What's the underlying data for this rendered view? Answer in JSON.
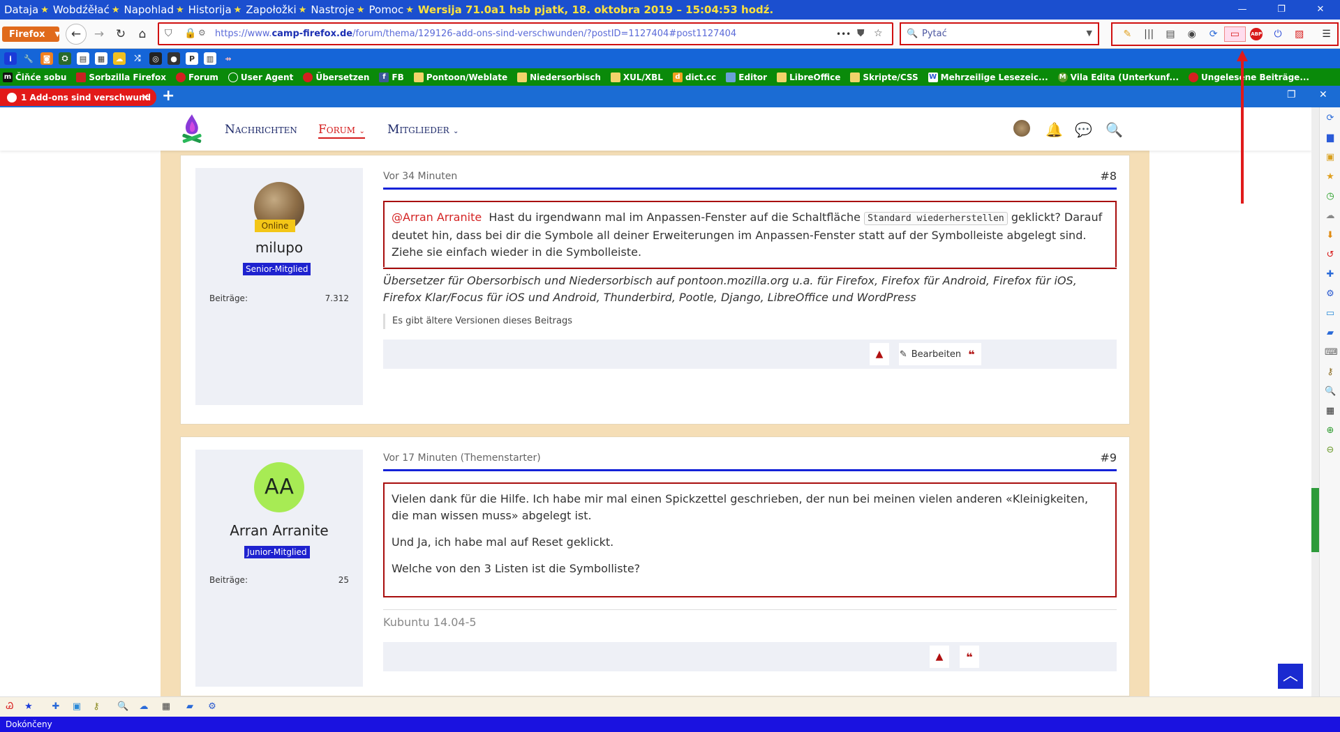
{
  "menubar": {
    "items": [
      "Dataja",
      "Wobdźěłać",
      "Napohlad",
      "Historija",
      "Zapołožki",
      "Nastroje",
      "Pomoc"
    ],
    "window_info": "Wersija 71.0a1 hsb   pjatk, 18. oktobra 2019  –  15:04:53 hodź."
  },
  "navbar": {
    "app_button": "Firefox",
    "url_prefix": "https://www.",
    "url_host": "camp-firefox.de",
    "url_path": "/forum/thema/129126-add-ons-sind-verschwunden/?postID=1127404#post1127404",
    "search_placeholder": "Pytać",
    "dots": "•••"
  },
  "bookmarks2": [
    {
      "label": "Čiňće sobu",
      "color": "#111"
    },
    {
      "label": "Sorbzilla Firefox",
      "color": "#c72222"
    },
    {
      "label": "Forum",
      "color": "#d42020"
    },
    {
      "label": "User Agent",
      "color": "#2a8a2a"
    },
    {
      "label": "Übersetzen",
      "color": "#d42020"
    },
    {
      "label": "FB",
      "color": "#3b5998"
    },
    {
      "label": "Pontoon/Weblate",
      "color": "#f2d36a"
    },
    {
      "label": "Niedersorbisch",
      "color": "#f2d36a"
    },
    {
      "label": "XUL/XBL",
      "color": "#f2d36a"
    },
    {
      "label": "dict.cc",
      "color": "#f0a020"
    },
    {
      "label": "Editor",
      "color": "#6aa0d8"
    },
    {
      "label": "LibreOffice",
      "color": "#f2d36a"
    },
    {
      "label": "Skripte/CSS",
      "color": "#f2d36a"
    },
    {
      "label": "Mehrzeilige Lesezeic...",
      "color": "#2a5ad0"
    },
    {
      "label": "Vila Edita (Unterkunf...",
      "color": "#5a9a2a"
    },
    {
      "label": "Ungelesene Beiträge...",
      "color": "#d42020"
    }
  ],
  "tab": {
    "title": "1 Add-ons sind verschwund",
    "close": "✕"
  },
  "site_nav": {
    "items": [
      "Nachrichten",
      "Forum",
      "Mitglieder"
    ]
  },
  "post8": {
    "time": "Vor 34 Minuten",
    "number": "#8",
    "online": "Online",
    "username": "milupo",
    "rank": "Senior-Mitglied",
    "posts_label": "Beiträge:",
    "posts_value": "7.312",
    "mention": "@Arran Arranite",
    "text_a": "Hast du irgendwann mal im Anpassen-Fenster auf die Schaltfläche",
    "code": "Standard wiederherstellen",
    "text_b": "geklickt? Darauf deutet hin, dass bei dir die Symbole all deiner Erweiterungen im Anpassen-Fenster statt auf der Symbolleiste abgelegt sind. Ziehe sie einfach wieder in die Symbolleiste.",
    "signature": "Übersetzer für Obersorbisch und Niedersorbisch auf pontoon.mozilla.org u.a. für Firefox, Firefox für Android, Firefox für iOS, Firefox Klar/Focus für iOS und Android, Thunderbird, Pootle, Django, LibreOffice und WordPress",
    "older_versions": "Es gibt ältere Versionen dieses Beitrags",
    "edit_label": "Bearbeiten"
  },
  "post9": {
    "time": "Vor 17 Minuten (Themenstarter)",
    "number": "#9",
    "avatar_initials": "AA",
    "username": "Arran Arranite",
    "rank": "Junior-Mitglied",
    "posts_label": "Beiträge:",
    "posts_value": "25",
    "para1": "Vielen dank für die Hilfe. Ich habe mir mal einen Spickzettel geschrieben, der nun bei meinen vielen anderen «Kleinigkeiten, die man wissen muss» abgelegt ist.",
    "para2": "Und Ja, ich habe mal auf Reset geklickt.",
    "para3": "Welche von den 3 Listen ist die Symbolliste?",
    "signature": "Kubuntu 14.04-5"
  },
  "statusbar": {
    "text": "Dokónčeny"
  }
}
